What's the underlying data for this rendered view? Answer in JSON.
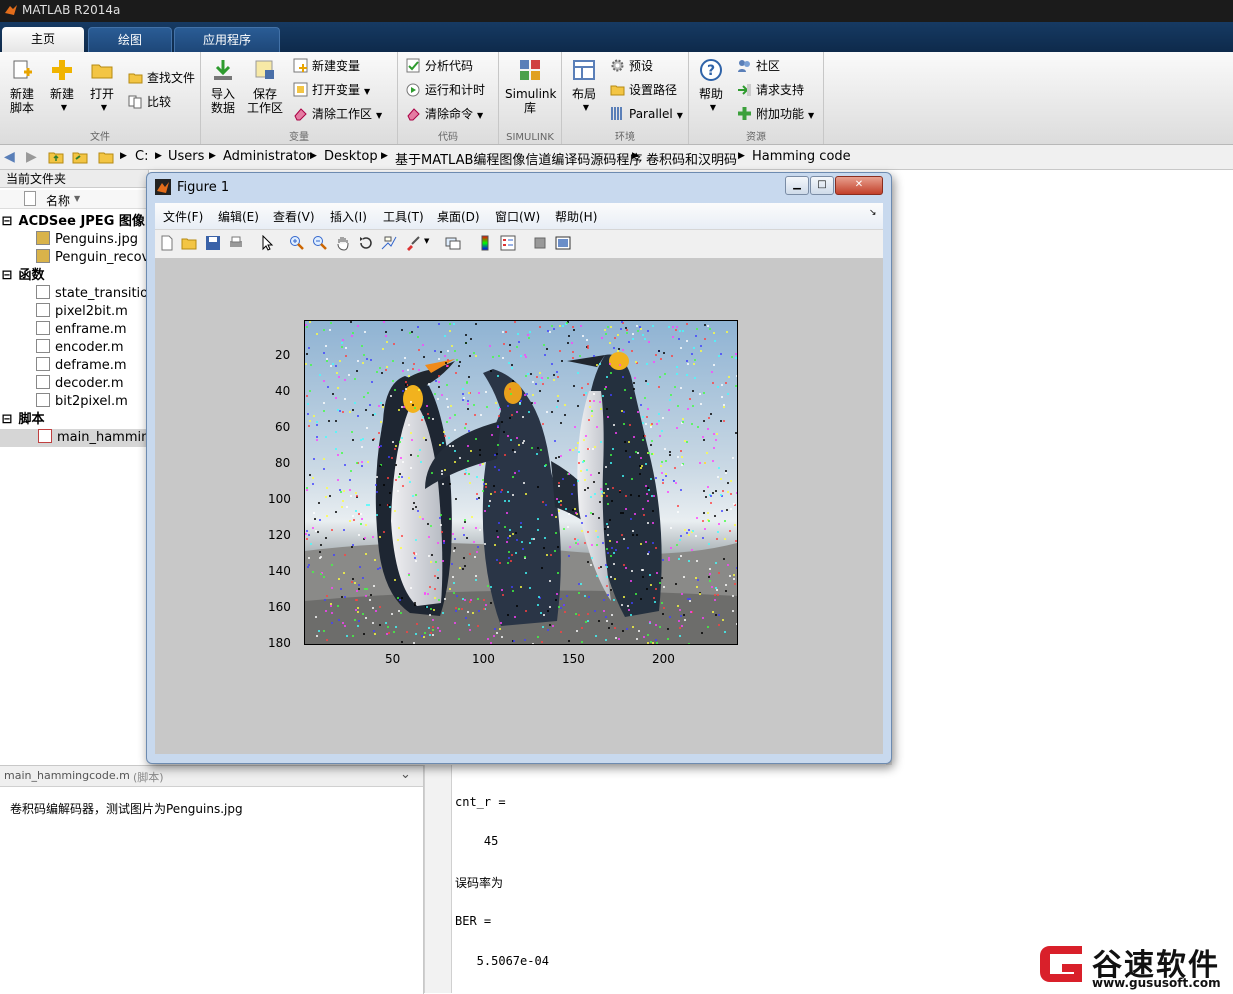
{
  "app": {
    "title": "MATLAB R2014a"
  },
  "tabs": [
    {
      "label": "主页"
    },
    {
      "label": "绘图"
    },
    {
      "label": "应用程序"
    }
  ],
  "ribbon": {
    "file": {
      "caption": "文件",
      "new_script": [
        "新建",
        "脚本"
      ],
      "new": "新建",
      "open": "打开",
      "find_files": "查找文件",
      "compare": "比较"
    },
    "variable": {
      "caption": "变量",
      "import_data": [
        "导入",
        "数据"
      ],
      "save_workspace": [
        "保存",
        "工作区"
      ],
      "new_variable": "新建变量",
      "open_variable": "打开变量",
      "clear_workspace": "清除工作区"
    },
    "code": {
      "caption": "代码",
      "analyze_code": "分析代码",
      "run_and_time": "运行和计时",
      "clear_commands": "清除命令"
    },
    "simulink": {
      "caption": "SIMULINK",
      "library": [
        "Simulink",
        "库"
      ]
    },
    "environment": {
      "caption": "环境",
      "layout": "布局",
      "preferences": "预设",
      "set_path": "设置路径",
      "parallel": "Parallel"
    },
    "resources": {
      "caption": "资源",
      "help": "帮助",
      "community": "社区",
      "request_support": "请求支持",
      "addons": "附加功能"
    }
  },
  "address": {
    "crumbs": [
      "C:",
      "Users",
      "Administrator",
      "Desktop",
      "基于MATLAB编程图像信道编译码源码程序",
      "卷积码和汉明码",
      "Hamming code"
    ]
  },
  "current_folder": {
    "title": "当前文件夹",
    "column_name": "名称",
    "groups": [
      {
        "label": "ACDSee JPEG 图像",
        "items": [
          "Penguins.jpg",
          "Penguin_recove"
        ]
      },
      {
        "label": "函数",
        "items": [
          "state_transition.",
          "pixel2bit.m",
          "enframe.m",
          "encoder.m",
          "deframe.m",
          "decoder.m",
          "bit2pixel.m"
        ]
      },
      {
        "label": "脚本",
        "items": [
          "main_hammingc"
        ]
      }
    ]
  },
  "details": {
    "file_name": "main_hammingcode.m",
    "file_type": "(脚本)",
    "description": "卷积码编解码器，测试图片为Penguins.jpg"
  },
  "command_window": {
    "lines": [
      "cnt_r =",
      "    45",
      "误码率为",
      "BER =",
      "   5.5067e-04"
    ]
  },
  "figure": {
    "title": "Figure 1",
    "menus": [
      "文件(F)",
      "编辑(E)",
      "查看(V)",
      "插入(I)",
      "工具(T)",
      "桌面(D)",
      "窗口(W)",
      "帮助(H)"
    ],
    "toolbar_icons": [
      "new-figure-icon",
      "open-icon",
      "save-icon",
      "print-icon",
      "pointer-icon",
      "zoom-in-icon",
      "zoom-out-icon",
      "pan-icon",
      "rotate-icon",
      "data-cursor-icon",
      "brush-icon",
      "link-icon",
      "colorbar-icon",
      "legend-icon",
      "hide-tools-icon",
      "show-tools-icon"
    ],
    "y_ticks": [
      "20",
      "40",
      "60",
      "80",
      "100",
      "120",
      "140",
      "160",
      "180"
    ],
    "x_ticks": [
      "50",
      "100",
      "150",
      "200"
    ]
  },
  "watermark": {
    "brand": "谷速软件",
    "url": "www.gususoft.com"
  }
}
